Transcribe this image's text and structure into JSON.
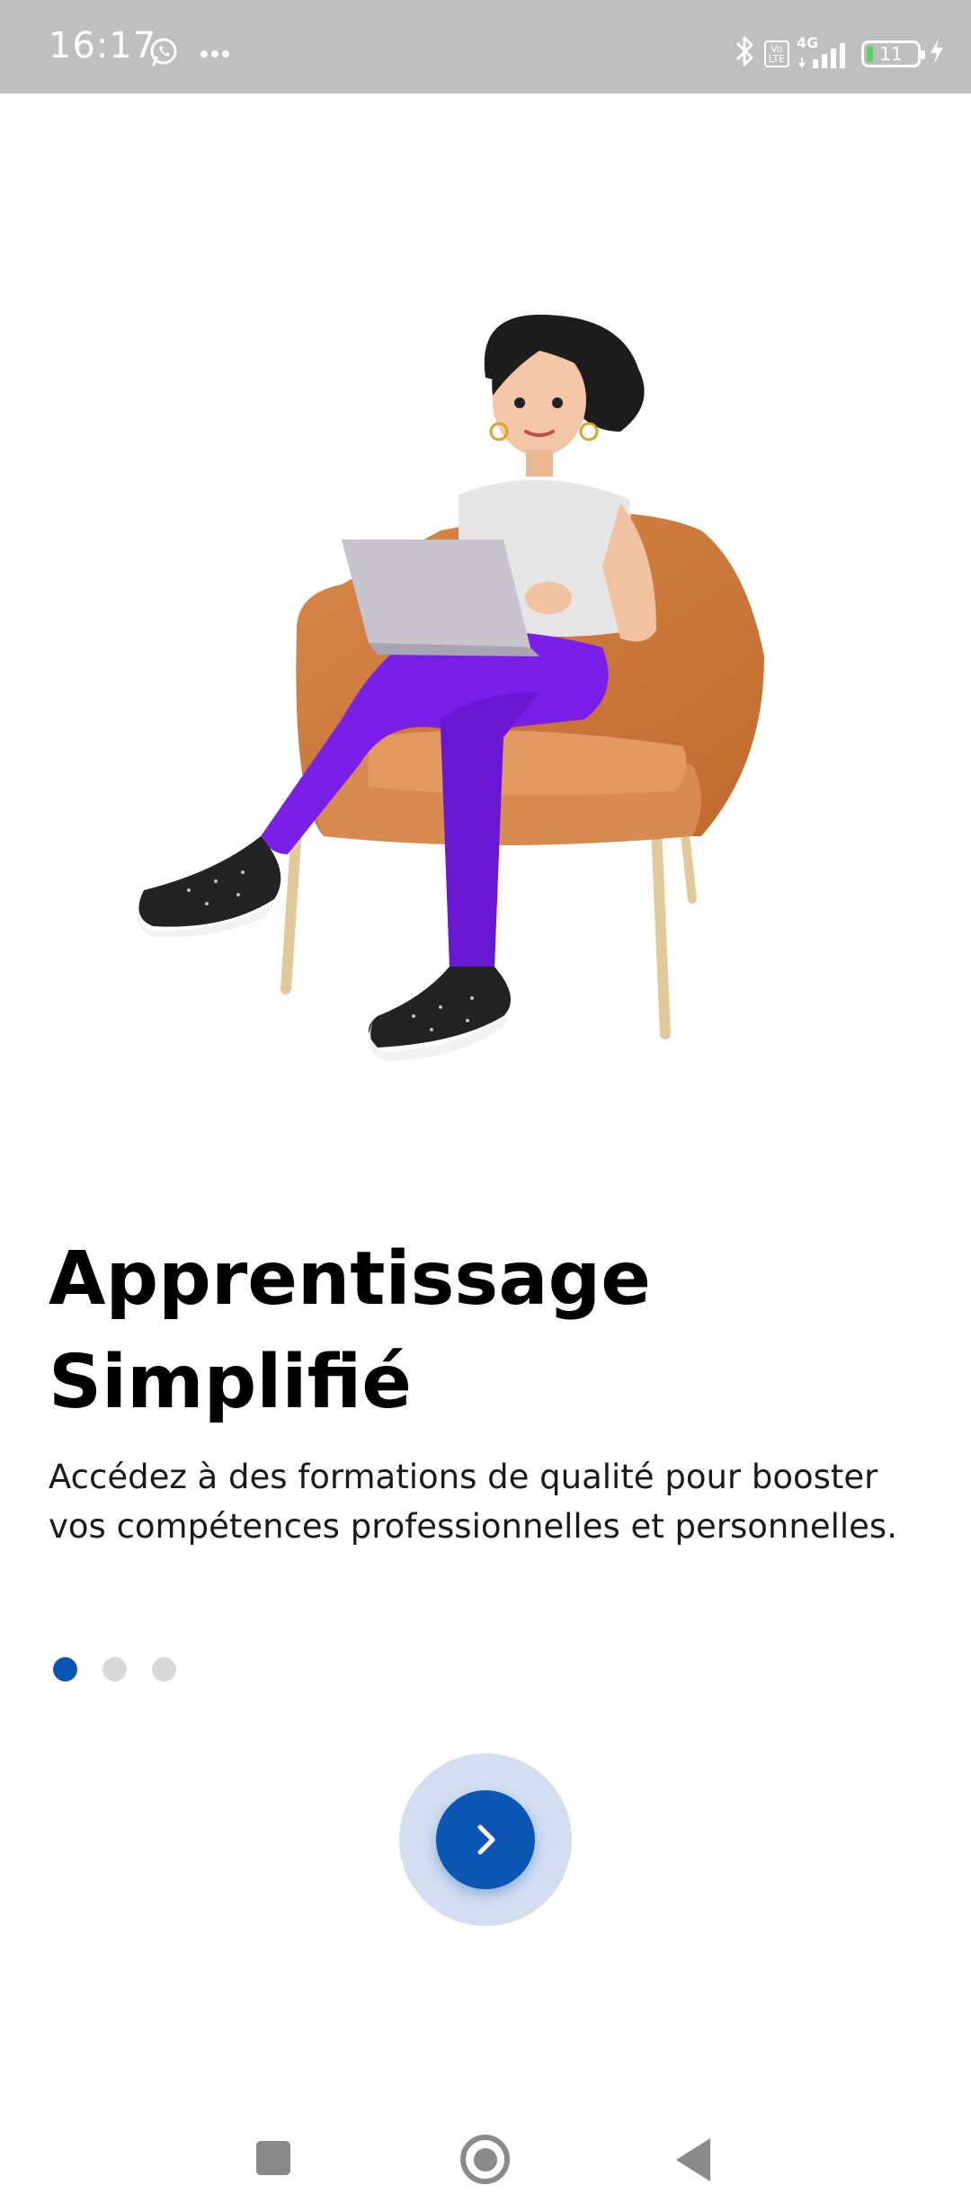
{
  "status_bar": {
    "time": "16:17",
    "battery_level": "11",
    "network": "4G",
    "volte_top": "Vo",
    "volte_bottom": "LTE",
    "left_icons": [
      "whatsapp-icon",
      "more-dots-icon"
    ],
    "right_icons": [
      "bluetooth-icon",
      "volte-icon",
      "signal-icon",
      "battery-icon",
      "charging-icon"
    ]
  },
  "onboarding": {
    "title_line1": "Apprentissage",
    "title_line2": "Simplifié",
    "description": "Accédez à des formations de qualité pour booster vos compétences professionnelles et personnelles.",
    "page_indicator": {
      "current": 1,
      "total": 3
    },
    "next_icon": "chevron-right-icon"
  },
  "colors": {
    "accent": "#0b56b3",
    "accent_halo": "#d3dff1",
    "dot_inactive": "#d9d9d9",
    "status_bar_bg": "#bfbfbf"
  },
  "navigation_bar": {
    "icons": [
      "recents-square-icon",
      "home-circle-icon",
      "back-triangle-icon"
    ]
  }
}
